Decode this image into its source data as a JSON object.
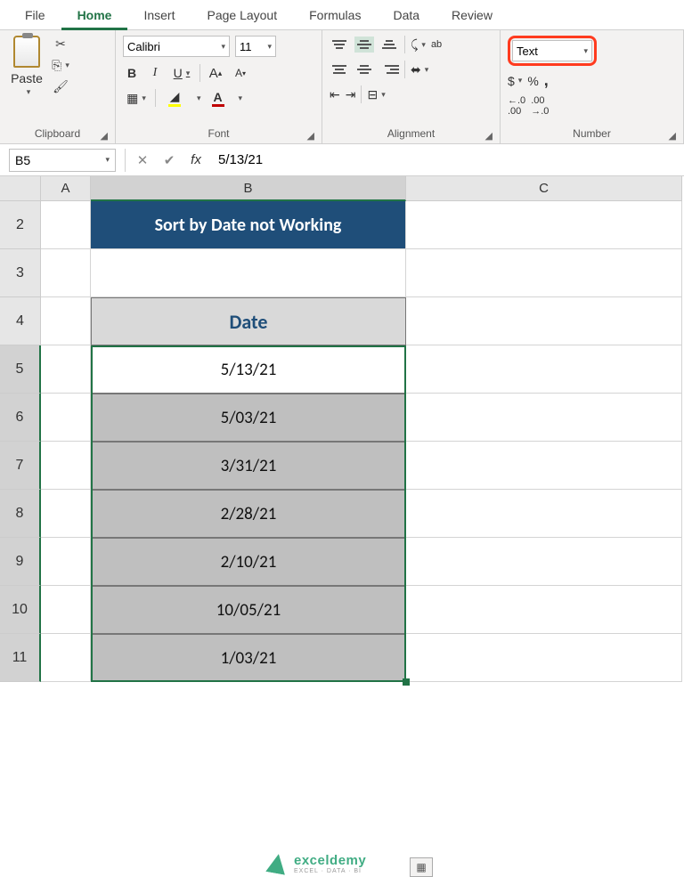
{
  "tabs": [
    "File",
    "Home",
    "Insert",
    "Page Layout",
    "Formulas",
    "Data",
    "Review"
  ],
  "active_tab": "Home",
  "ribbon": {
    "clipboard": {
      "label": "Clipboard",
      "paste": "Paste"
    },
    "font": {
      "label": "Font",
      "name": "Calibri",
      "size": "11",
      "bold": "B",
      "italic": "I",
      "underline": "U",
      "increase": "A",
      "decrease": "A"
    },
    "alignment": {
      "label": "Alignment",
      "wrap": "ab"
    },
    "number": {
      "label": "Number",
      "format": "Text",
      "currency": "$",
      "percent": "%",
      "comma": ",",
      "inc_dec": ".0",
      "dec_dec": ".00"
    }
  },
  "namebox": "B5",
  "formula": "5/13/21",
  "columns": [
    "A",
    "B",
    "C"
  ],
  "rows": [
    "2",
    "3",
    "4",
    "5",
    "6",
    "7",
    "8",
    "9",
    "10",
    "11"
  ],
  "sheet": {
    "title": "Sort by Date not Working",
    "header": "Date",
    "data": [
      "5/13/21",
      "5/03/21",
      "3/31/21",
      "2/28/21",
      "2/10/21",
      "10/05/21",
      "1/03/21"
    ]
  },
  "chart_data": {
    "type": "table",
    "title": "Sort by Date not Working",
    "columns": [
      "Date"
    ],
    "rows": [
      [
        "5/13/21"
      ],
      [
        "5/03/21"
      ],
      [
        "3/31/21"
      ],
      [
        "2/28/21"
      ],
      [
        "2/10/21"
      ],
      [
        "10/05/21"
      ],
      [
        "1/03/21"
      ]
    ]
  },
  "watermark": {
    "brand": "exceldemy",
    "tag": "EXCEL · DATA · BI"
  }
}
